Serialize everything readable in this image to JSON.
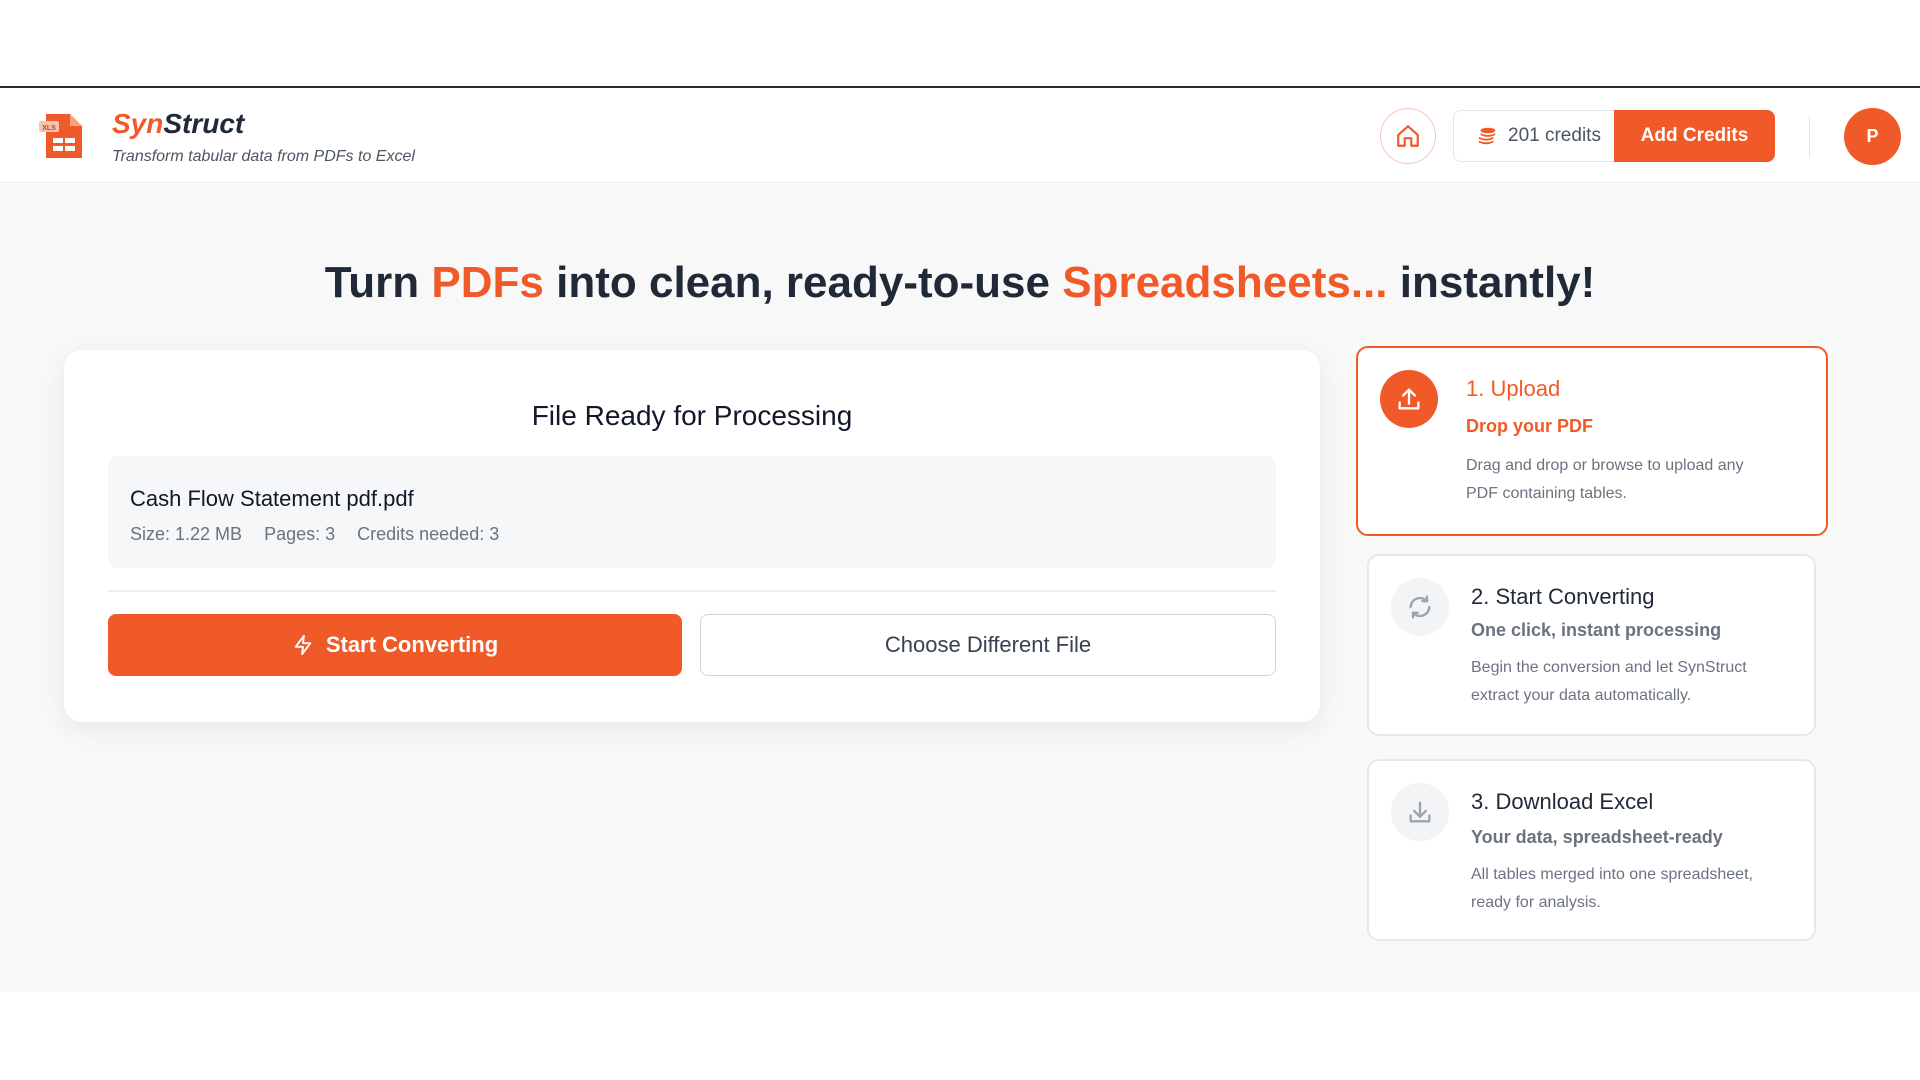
{
  "brand": {
    "name_part1": "Syn",
    "name_part2": "Struct",
    "tagline": "Transform tabular data from PDFs to Excel",
    "logo_badge": "XLS"
  },
  "header": {
    "credits": "201 credits",
    "add_credits_label": "Add Credits",
    "avatar_initial": "P"
  },
  "hero": {
    "part1": "Turn ",
    "accent1": "PDFs",
    "part2": " into clean, ready-to-use ",
    "accent2": "Spreadsheets...",
    "part3": " instantly!"
  },
  "card": {
    "title": "File Ready for Processing",
    "file_name": "Cash Flow Statement pdf.pdf",
    "size": "Size: 1.22 MB",
    "pages": "Pages: 3",
    "credits_needed": "Credits needed: 3",
    "start_label": "Start Converting",
    "choose_label": "Choose Different File"
  },
  "steps": [
    {
      "title": "1. Upload",
      "subtitle": "Drop your PDF",
      "desc1": "Drag and drop or browse to upload any",
      "desc2": "PDF containing tables.",
      "icon": "upload-icon"
    },
    {
      "title": "2. Start Converting",
      "subtitle": "One click, instant processing",
      "desc1": "Begin the conversion and let SynStruct",
      "desc2": "extract your data automatically.",
      "icon": "refresh-icon"
    },
    {
      "title": "3. Download Excel",
      "subtitle": "Your data, spreadsheet-ready",
      "desc1": "All tables merged into one spreadsheet,",
      "desc2": "ready for analysis.",
      "icon": "download-icon"
    }
  ],
  "colors": {
    "accent": "#f05a28",
    "text": "#1f2937",
    "muted": "#6b7280"
  }
}
